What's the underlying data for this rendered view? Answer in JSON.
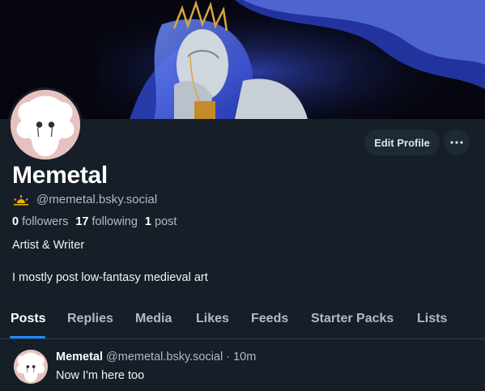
{
  "profile": {
    "display_name": "Memetal",
    "handle": "@memetal.bsky.social",
    "followers_count": "0",
    "followers_label": "followers",
    "following_count": "17",
    "following_label": "following",
    "posts_count": "1",
    "posts_label": "post",
    "bio_line1": "Artist & Writer",
    "bio_line2": "I mostly post low-fantasy medieval art",
    "badge_icon": "sunrise-icon",
    "badge_color": "#f5b301"
  },
  "actions": {
    "edit_label": "Edit Profile",
    "more_icon": "ellipsis-icon"
  },
  "tabs": [
    {
      "label": "Posts",
      "active": true
    },
    {
      "label": "Replies",
      "active": false
    },
    {
      "label": "Media",
      "active": false
    },
    {
      "label": "Likes",
      "active": false
    },
    {
      "label": "Feeds",
      "active": false
    },
    {
      "label": "Starter Packs",
      "active": false
    },
    {
      "label": "Lists",
      "active": false
    }
  ],
  "post": {
    "author": "Memetal",
    "handle": "@memetal.bsky.social",
    "time": "· 10m",
    "text": "Now I'm here too"
  },
  "colors": {
    "background": "#161e27",
    "accent": "#208bfe",
    "muted_text": "#aebbc9"
  }
}
